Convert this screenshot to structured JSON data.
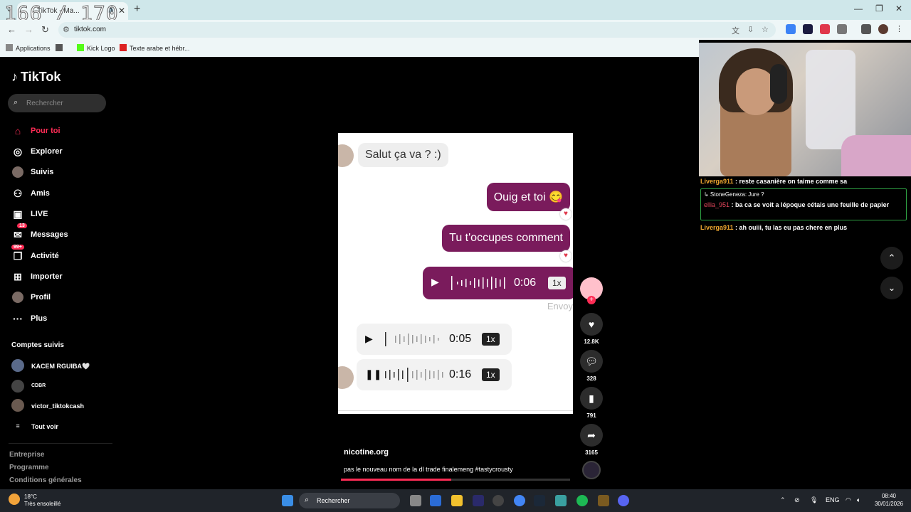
{
  "browser": {
    "counter": "166 / 170",
    "tab_title": "TikTok - Ma...",
    "url": "tiktok.com",
    "bookmarks": [
      "Applications",
      "Kick Logo",
      "Texte arabe et hébr..."
    ]
  },
  "tiktok": {
    "logo": "TikTok",
    "search_placeholder": "Rechercher",
    "nav": [
      {
        "label": "Pour toi",
        "icon": "home-icon"
      },
      {
        "label": "Explorer",
        "icon": "compass-icon"
      },
      {
        "label": "Suivis",
        "icon": "following-avatar-icon"
      },
      {
        "label": "Amis",
        "icon": "friends-icon"
      },
      {
        "label": "LIVE",
        "icon": "live-icon"
      },
      {
        "label": "Messages",
        "icon": "messages-icon",
        "badge": "13"
      },
      {
        "label": "Activité",
        "icon": "activity-icon",
        "badge": "99+"
      },
      {
        "label": "Importer",
        "icon": "upload-icon"
      },
      {
        "label": "Profil",
        "icon": "profile-avatar-icon"
      },
      {
        "label": "Plus",
        "icon": "more-icon"
      }
    ],
    "followed_title": "Comptes suivis",
    "followed": [
      "KACEM RGUIBA🤍",
      "CDBR",
      "victor_tiktokcash"
    ],
    "see_all": "Tout voir",
    "footer": [
      "Entreprise",
      "Programme",
      "Conditions générales"
    ]
  },
  "video": {
    "msg_left": "Salut ça va ? :)",
    "msg_right_1": "Ouig et toi 😋",
    "msg_right_2": "Tu t'occupes comment",
    "voice_1": {
      "duration": "0:06",
      "speed": "1x"
    },
    "sent_label": "Envoy",
    "voice_2": {
      "duration": "0:05",
      "speed": "1x"
    },
    "voice_3": {
      "duration": "0:16",
      "speed": "1x"
    },
    "username": "nicotine.org",
    "description": "pas le nouveau nom de la dl trade finalemeng #tastycrousty",
    "progress": 0.48
  },
  "actions": {
    "likes": "12.8K",
    "comments": "328",
    "saves": "791",
    "shares": "3165"
  },
  "chat": {
    "msg1_user": "Liverga911",
    "msg1_text": " : reste casanière on taime comme sa",
    "reply_quote": "↳ StoneGeneza: Jure ?",
    "reply_user": "ellia_951",
    "reply_text": " : ba ca se voit a lépoque cétais une feuille de papier",
    "msg3_user": "Liverga911",
    "msg3_text": " : ah ouiii, tu las eu pas chere en plus"
  },
  "taskbar": {
    "temp": "18°C",
    "weather": "Très ensoleillé",
    "search": "Rechercher",
    "lang": "ENG",
    "time": "08:40",
    "date": "30/01/2026"
  },
  "colors": {
    "accent": "#fe2c55",
    "bubble": "#7a1b5c",
    "chat_user": "#f0a830"
  }
}
